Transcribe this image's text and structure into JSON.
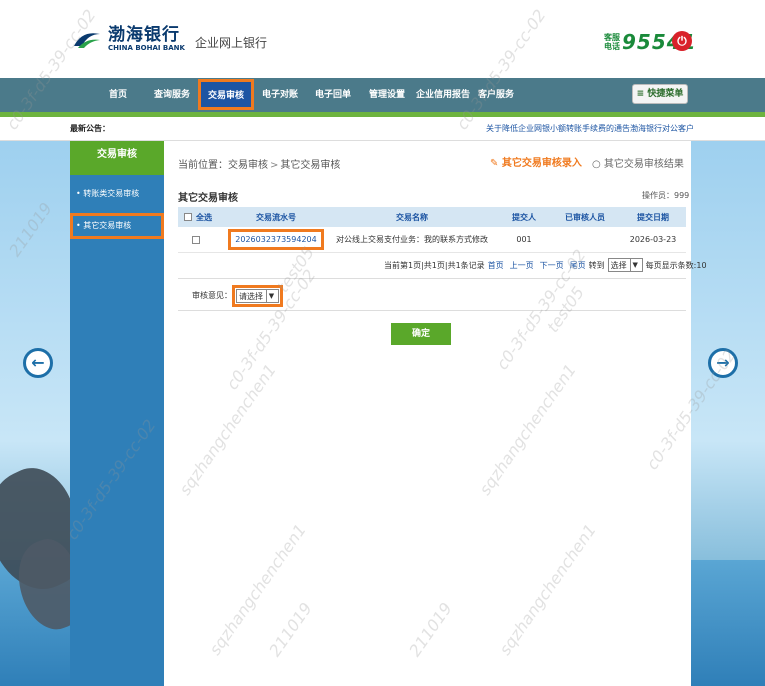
{
  "header": {
    "logo_cn": "渤海银行",
    "logo_en": "CHINA BOHAI BANK",
    "subtitle": "企业网上银行",
    "hotline_label": "客服电话",
    "hotline_number": "95541",
    "power_icon": "power-icon"
  },
  "nav": {
    "items": [
      {
        "label": "首页"
      },
      {
        "label": "查询服务"
      },
      {
        "label": "交易审核"
      },
      {
        "label": "电子对账"
      },
      {
        "label": "电子回单"
      },
      {
        "label": "管理设置"
      },
      {
        "label": "企业信用报告"
      },
      {
        "label": "客户服务"
      }
    ],
    "active_index": 2,
    "quick_menu": "≡ 快捷菜单"
  },
  "notice": {
    "label": "最新公告：",
    "items": [
      "关于降低企业网银小额转账手续费的通告",
      "渤海银行对公客户"
    ]
  },
  "sidebar": {
    "title": "交易审核",
    "items": [
      {
        "label": "• 转账类交易审核"
      },
      {
        "label": "• 其它交易审核"
      }
    ],
    "active_index": 1
  },
  "main": {
    "breadcrumb": {
      "label": "当前位置：",
      "level1": "交易审核",
      "sep": ">",
      "level2": "其它交易审核"
    },
    "link_entry": "其它交易审核录入",
    "link_result": "其它交易审核结果",
    "section_title": "其它交易审核",
    "operator": "操作员：999",
    "table": {
      "headers": [
        "全选",
        "交易流水号",
        "交易名称",
        "提交人",
        "已审核人员",
        "提交日期"
      ],
      "rows": [
        {
          "txn_no": "2026032373594204",
          "txn_name": "对公线上交易支付业务：我的联系方式修改",
          "submitter": "001",
          "reviewed_by": "",
          "date": "2026-03-23"
        }
      ]
    },
    "pager": {
      "summary": "当前第1页|共1页|共1条记录",
      "first": "首页",
      "prev": "上一页",
      "next": "下一页",
      "last": "尾页",
      "goto_label": "转到",
      "goto_value": "选择",
      "per_page": "每页显示条数:10"
    },
    "opinion_label": "审核意见：",
    "opinion_value": "请选择",
    "confirm_label": "确定"
  },
  "watermark": {
    "lines": [
      "c0-3f-d5-39-cc-02",
      "test05",
      "211019",
      "sqzhangchenchen1"
    ]
  },
  "colors": {
    "nav_bg": "#4b7a8a",
    "active_nav": "#1d55a3",
    "highlight": "#f07a1f",
    "green": "#5aa82a",
    "sidebar": "#2f7fb8"
  }
}
